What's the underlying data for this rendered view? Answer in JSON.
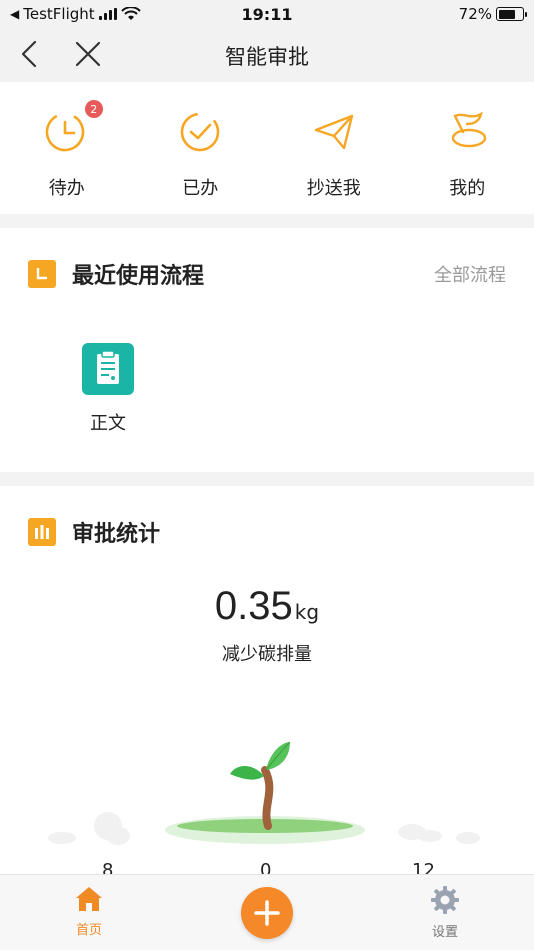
{
  "status_bar": {
    "carrier": "TestFlight",
    "time": "19:11",
    "battery": "72%",
    "battery_level": 0.72
  },
  "nav": {
    "title": "智能审批"
  },
  "quick_actions": [
    {
      "label": "待办",
      "icon": "clock-icon",
      "badge": "2"
    },
    {
      "label": "已办",
      "icon": "check-circle-icon"
    },
    {
      "label": "抄送我",
      "icon": "paper-plane-icon"
    },
    {
      "label": "我的",
      "icon": "flag-icon"
    }
  ],
  "recent": {
    "title": "最近使用流程",
    "all_link": "全部流程",
    "items": [
      {
        "label": "正文",
        "icon": "clipboard-icon"
      }
    ]
  },
  "stats": {
    "title": "审批统计",
    "value": "0.35",
    "unit": "kg",
    "caption": "减少碳排量",
    "bottom_numbers": [
      "8",
      "0",
      "12"
    ]
  },
  "tab_bar": {
    "home_label": "首页",
    "settings_label": "设置"
  },
  "colors": {
    "accent": "#f5a623",
    "orange_button": "#f5892a",
    "teal": "#1bb5a6",
    "badge": "#e85a5a"
  }
}
